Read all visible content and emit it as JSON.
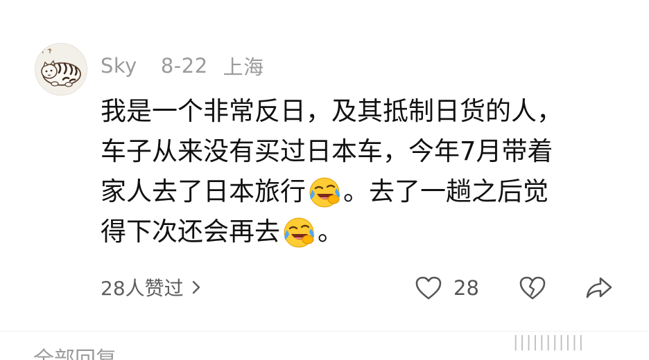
{
  "comment": {
    "user": {
      "name": "Sky",
      "avatar": "tiger-cat-avatar"
    },
    "date": "8-22",
    "location": "上海",
    "lines": [
      {
        "text": "我是一个非常反日，及其抵制日货的人，"
      },
      {
        "text": "车子从来没有买过日本车，今年7月带着"
      },
      {
        "before": "家人去了日本旅行",
        "emoji": "laughing-crying-emoji",
        "after": "。去了一趟之后觉"
      },
      {
        "before": "得下次还会再去",
        "emoji": "laughing-crying-emoji",
        "after": "。"
      }
    ]
  },
  "actions": {
    "likes_text": "28人赞过",
    "like_count": "28",
    "icons": {
      "like": "heart-icon",
      "dislike": "broken-heart-icon",
      "share": "share-icon",
      "chevron": "chevron-right-icon"
    }
  },
  "footer": {
    "replies_label": "全部回复",
    "watermark": "|||||||||||"
  },
  "colors": {
    "text": "#111111",
    "meta": "#9a9a9a",
    "action": "#555555",
    "background": "#ffffff"
  }
}
